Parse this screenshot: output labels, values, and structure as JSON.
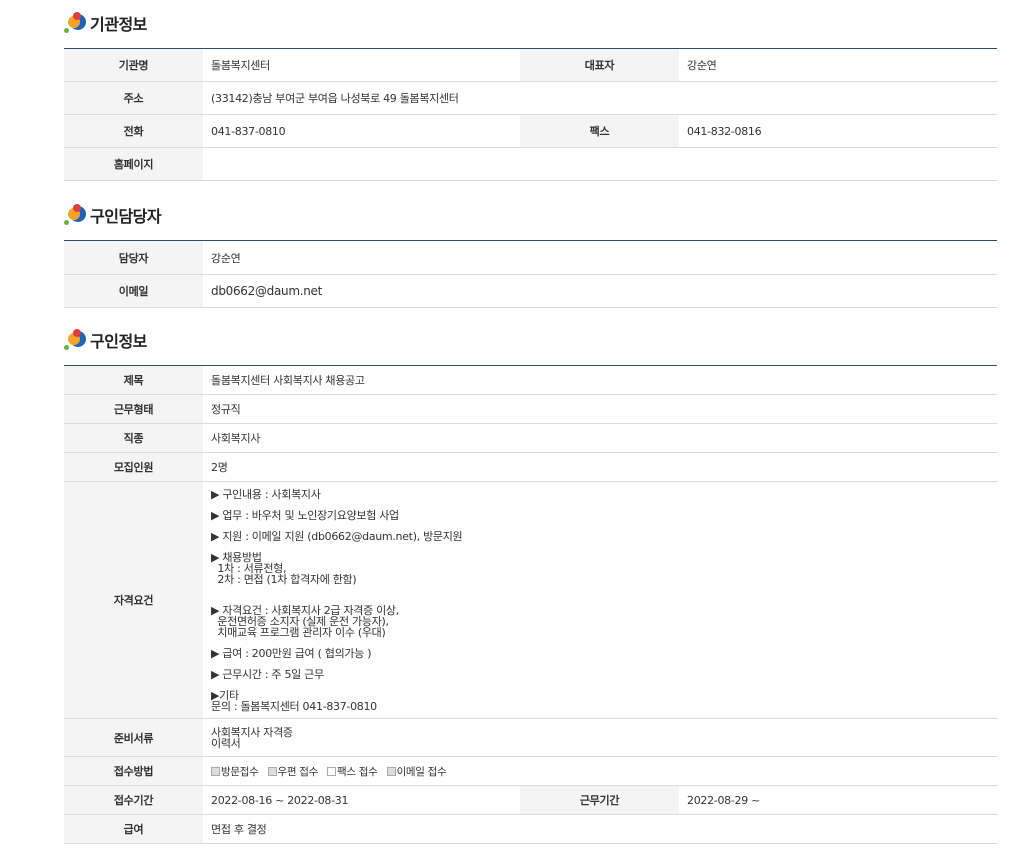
{
  "sections": {
    "agency": {
      "title": "기관정보",
      "labels": {
        "name": "기관명",
        "rep": "대표자",
        "address": "주소",
        "phone": "전화",
        "fax": "팩스",
        "homepage": "홈페이지"
      },
      "values": {
        "name": "돌봄복지센터",
        "rep": "강순연",
        "address": "(33142)충남 부여군 부여읍 나성북로 49 돌봄복지센터",
        "phone": "041-837-0810",
        "fax": "041-832-0816",
        "homepage": ""
      }
    },
    "contact": {
      "title": "구인담당자",
      "labels": {
        "person": "담당자",
        "email": "이메일"
      },
      "values": {
        "person": "강순연",
        "email": "db0662@daum.net"
      }
    },
    "job": {
      "title": "구인정보",
      "labels": {
        "subject": "제목",
        "worktype": "근무형태",
        "category": "직종",
        "headcount": "모집인원",
        "qualification": "자격요건",
        "documents": "준비서류",
        "method": "접수방법",
        "period": "접수기간",
        "workperiod": "근무기간",
        "salary": "급여"
      },
      "values": {
        "subject": "돌봄복지센터 사회복지사 채용공고",
        "worktype": "정규직",
        "category": "사회복지사",
        "headcount": "2명",
        "qualification": [
          "▶ 구인내용 : 사회복지사",
          "▶ 업무 : 바우처 및 노인장기요양보험 사업",
          "▶ 지원 : 이메일 지원 (db0662@daum.net), 방문지원",
          "▶ 채용방법",
          "  1차 : 서류전형,",
          "  2차 : 면접 (1차 합격자에 한함)",
          "▶ 자격요건 : 사회복지사 2급 자격증 이상,",
          "  운전면허증 소지자 (실제 운전 가능자),",
          "  치매교육 프로그램 관리자 이수 (우대)",
          "▶ 급여 : 200만원 급여 ( 협의가능 )",
          "▶ 근무시간 : 주 5일 근무",
          "▶기타",
          "문의 : 돌봄복지센터 041-837-0810"
        ],
        "documents": [
          "사회복지사 자격증",
          "이력서"
        ],
        "method": [
          {
            "label": "방문접수",
            "checked": true
          },
          {
            "label": "우편 접수",
            "checked": true
          },
          {
            "label": "팩스 접수",
            "checked": false
          },
          {
            "label": "이메일 접수",
            "checked": true
          }
        ],
        "period": "2022-08-16 ~ 2022-08-31",
        "workperiod": "2022-08-29 ~",
        "salary": "면접 후 결정"
      }
    }
  }
}
